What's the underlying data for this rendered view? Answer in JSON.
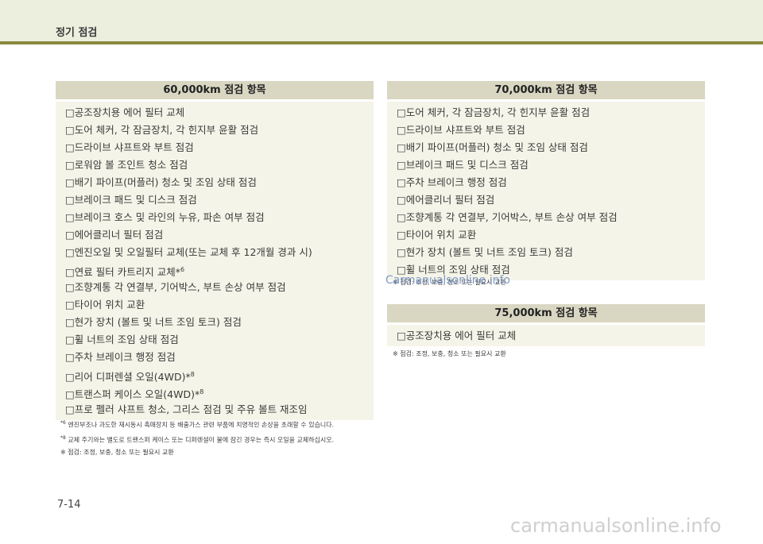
{
  "header": {
    "title": "정기 점검"
  },
  "box60": {
    "title": "60,000km 점검 항목",
    "items": [
      {
        "text": "□공조장치용 에어 필터 교체",
        "sup": ""
      },
      {
        "text": "□도어 체커, 각 잠금장치, 각 힌지부 윤활 점검",
        "sup": ""
      },
      {
        "text": "□드라이브 샤프트와 부트 점검",
        "sup": ""
      },
      {
        "text": "□로워암 볼 조인트 청소 점검",
        "sup": ""
      },
      {
        "text": "□배기 파이프(머플러) 청소 및 조임 상태 점검",
        "sup": ""
      },
      {
        "text": "□브레이크 패드 및 디스크 점검",
        "sup": ""
      },
      {
        "text": "□브레이크 호스 및 라인의 누유, 파손 여부 점검",
        "sup": ""
      },
      {
        "text": "□에어클리너 필터 점검",
        "sup": ""
      },
      {
        "text": "□엔진오일 및 오일필터  교체(또는 교체 후 12개월 경과 시)",
        "sup": ""
      },
      {
        "text": "□연료 필터 카트리지 교체*",
        "sup": "6"
      },
      {
        "text": "□조향계통 각 연결부, 기어박스, 부트 손상 여부 점검",
        "sup": ""
      },
      {
        "text": "□타이어 위치 교환",
        "sup": ""
      },
      {
        "text": "□현가 장치 (볼트 및 너트 조임 토크) 점검",
        "sup": ""
      },
      {
        "text": "□휠 너트의 조임 상태 점검",
        "sup": ""
      },
      {
        "text": "□주차 브레이크 행정 점검",
        "sup": ""
      },
      {
        "text": "□리어 디퍼렌셜 오일(4WD)*",
        "sup": "8"
      },
      {
        "text": "□트랜스퍼 케이스 오일(4WD)*",
        "sup": "8"
      },
      {
        "text": "□프로 펠러 샤프트 청소, 그리스 점검 및 주유 볼트 재조임",
        "sup": ""
      }
    ]
  },
  "notes60": [
    {
      "mark": "*6",
      "text": "엔진부조나 과도한 재시동시 촉매장치 등 배출가스 관련 부품에 치명적인 손상을 초래할 수 있습니다."
    },
    {
      "mark": "*8",
      "text": "교체 주기와는 별도로 트랜스퍼 케이스 또는 디퍼렌셜이 물에 잠긴 경우는 즉시 오일을 교체하십시오."
    },
    {
      "mark": "",
      "text": "※ 점검: 조정, 보충, 청소 또는 필요시 교환"
    }
  ],
  "box70": {
    "title": "70,000km 점검 항목",
    "items": [
      {
        "text": "□도어 체커, 각 잠금장치, 각 힌지부 윤활 점검",
        "sup": ""
      },
      {
        "text": "□드라이브 샤프트와 부트 점검",
        "sup": ""
      },
      {
        "text": "□배기 파이프(머플러) 청소 및 조임 상태 점검",
        "sup": ""
      },
      {
        "text": "□브레이크 패드 및 디스크 점검",
        "sup": ""
      },
      {
        "text": "□주차 브레이크 행정 점검",
        "sup": ""
      },
      {
        "text": "□에어클리너 필터 점검",
        "sup": ""
      },
      {
        "text": "□조향계통 각 연결부, 기어박스, 부트 손상 여부 점검",
        "sup": ""
      },
      {
        "text": "□타이어 위치 교환",
        "sup": ""
      },
      {
        "text": "□현가 장치 (볼트 및 너트 조임 토크) 점검",
        "sup": ""
      },
      {
        "text": "□휠 너트의 조임 상태 점검",
        "sup": ""
      }
    ]
  },
  "note70": "※ 점검: 조정, 보충, 청소 또는 필요시 교환",
  "box75": {
    "title": "75,000km 점검 항목",
    "items": [
      {
        "text": "□공조장치용 에어 필터 교체",
        "sup": ""
      }
    ]
  },
  "note75": "※ 점검: 조정, 보충, 청소 또는 필요시 교환",
  "watermark_mid": "Carmanualsonline.info",
  "page_number": "7-14",
  "watermark_bottom": "carmanualsonline.info"
}
